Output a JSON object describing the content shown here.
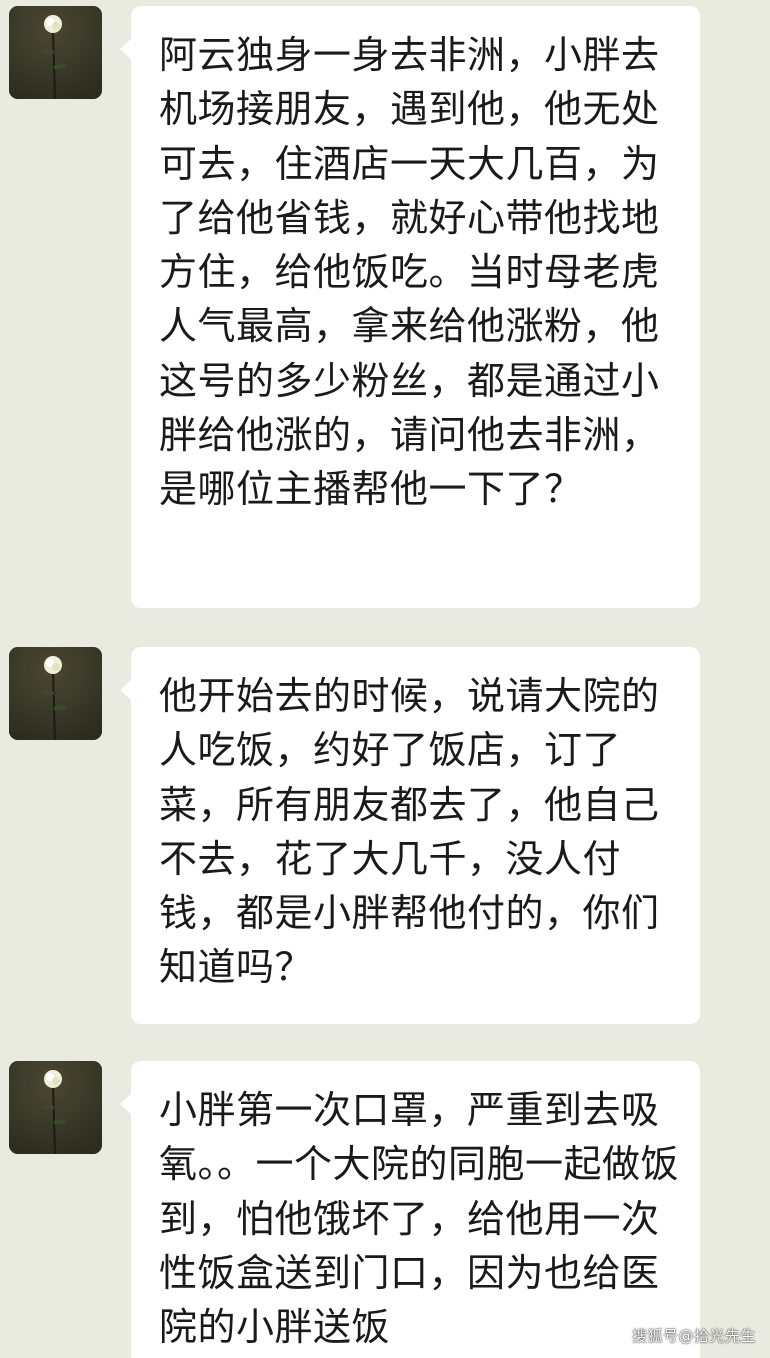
{
  "chat": {
    "messages": [
      {
        "avatar_icon": "white-rose-avatar",
        "text": "阿云独身一身去非洲，小胖去机场接朋友，遇到他，他无处可去，住酒店一天大几百，为了给他省钱，就好心带他找地方住，给他饭吃。当时母老虎人气最高，拿来给他涨粉，他这号的多少粉丝，都是通过小胖给他涨的，请问他去非洲，是哪位主播帮他一下了？"
      },
      {
        "avatar_icon": "white-rose-avatar",
        "text": "他开始去的时候，说请大院的人吃饭，约好了饭店，订了菜，所有朋友都去了，他自己不去，花了大几千，没人付钱，都是小胖帮他付的，你们知道吗？"
      },
      {
        "avatar_icon": "white-rose-avatar",
        "text": "小胖第一次口罩，严重到去吸氧。。一个大院的同胞一起做饭到，怕他饿坏了，给他用一次性饭盒送到门口，因为也给医院的小胖送饭"
      }
    ]
  },
  "watermark": {
    "text": "搜狐号@拾光先生"
  },
  "colors": {
    "background": "#e9ebe0",
    "bubble": "#ffffff",
    "text": "#1a1a1a"
  }
}
